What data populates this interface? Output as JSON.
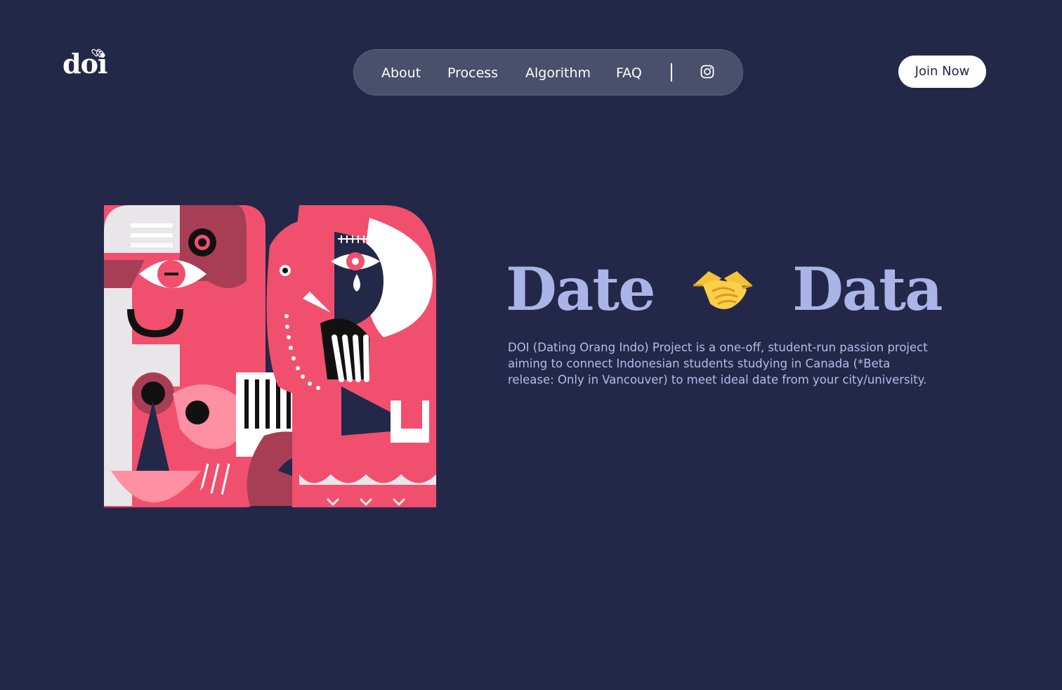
{
  "brand": {
    "logo_text": "doi",
    "logo_icon": "hearts-icon"
  },
  "nav": {
    "items": [
      {
        "label": "About"
      },
      {
        "label": "Process"
      },
      {
        "label": "Algorithm"
      },
      {
        "label": "FAQ"
      }
    ],
    "social_icon": "instagram-icon"
  },
  "cta": {
    "join_label": "Join Now"
  },
  "hero": {
    "title_left": "Date",
    "title_emoji": "handshake-icon",
    "title_right": "Data",
    "description": "DOI (Dating Orang Indo) Project is a one-off, student-run passion project aiming to connect Indonesian students studying in Canada (*Beta release: Only in Vancouver) to meet ideal date from your city/university.",
    "illustration": "abstract-faces-illustration"
  },
  "colors": {
    "background": "#242848",
    "nav_pill": "#4a4f6b",
    "headline": "#aab4e6",
    "body_text": "#b4bbe8",
    "art_pink": "#f0506e",
    "art_rose": "#a83e55"
  }
}
